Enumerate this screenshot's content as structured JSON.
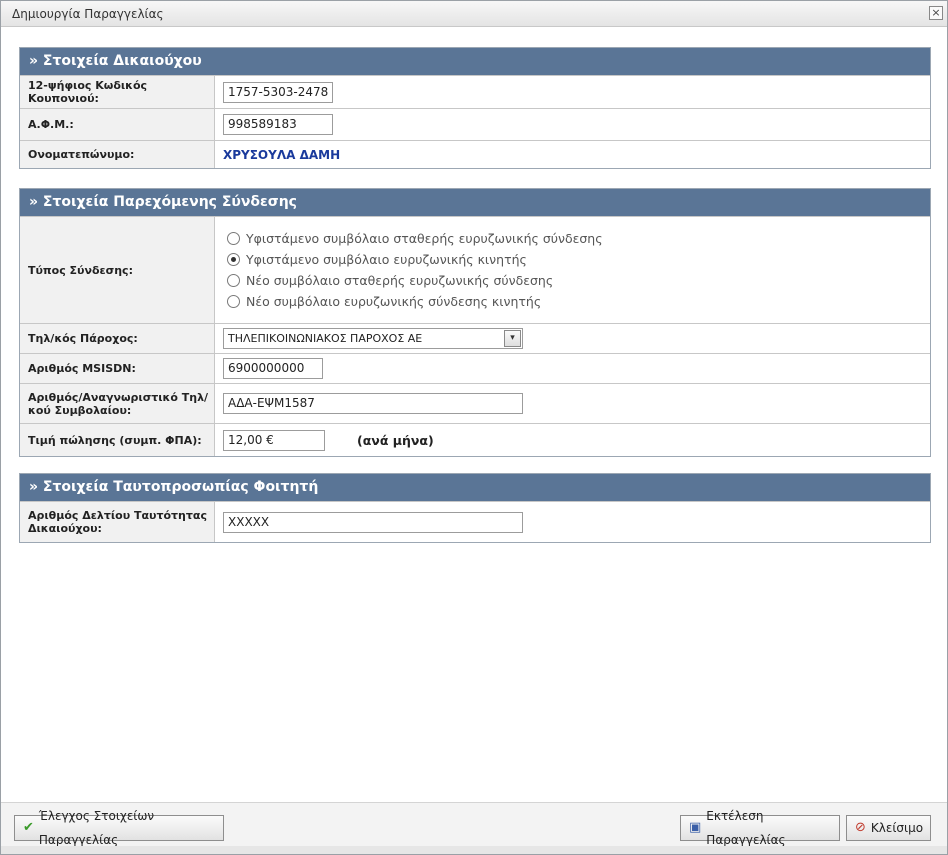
{
  "window": {
    "title": "Δημιουργία Παραγγελίας",
    "close_label": "×"
  },
  "beneficiary": {
    "header": "» Στοιχεία Δικαιούχου",
    "coupon_label": "12-ψήφιος Κωδικός Κουπονιού:",
    "coupon_value": "1757-5303-2478",
    "afm_label": "Α.Φ.Μ.:",
    "afm_value": "998589183",
    "name_label": "Ονοματεπώνυμο:",
    "name_value": "ΧΡΥΣΟΥΛΑ ΔΑΜΗ"
  },
  "connection": {
    "header": "» Στοιχεία Παρεχόμενης Σύνδεσης",
    "type_label": "Τύπος Σύνδεσης:",
    "type_options": [
      "Υφιστάμενο συμβόλαιο σταθερής ευρυζωνικής σύνδεσης",
      "Υφιστάμενο συμβόλαιο ευρυζωνικής κινητής",
      "Νέο συμβόλαιο σταθερής ευρυζωνικής σύνδεσης",
      "Νέο συμβόλαιο ευρυζωνικής σύνδεσης κινητής"
    ],
    "selected_option": 1,
    "provider_label": "Τηλ/κός Πάροχος:",
    "provider_value": "ΤΗΛΕΠΙΚΟΙΝΩΝΙΑΚΟΣ ΠΑΡΟΧΟΣ ΑΕ",
    "msisdn_label": "Αριθμός MSISDN:",
    "msisdn_value": "6900000000",
    "contract_label": "Αριθμός/Αναγνωριστικό Τηλ/κού Συμβολαίου:",
    "contract_value": "ΑΔΑ-ΕΨΜ1587",
    "price_label": "Τιμή πώλησης (συμπ. ΦΠΑ):",
    "price_value": "12,00 €",
    "price_suffix": "(ανά μήνα)"
  },
  "student": {
    "header": "» Στοιχεία Ταυτοπροσωπίας Φοιτητή",
    "id_label": "Αριθμός Δελτίου Ταυτότητας Δικαιούχου:",
    "id_value": "XXXXX"
  },
  "footer": {
    "check_button": "Έλεγχος Στοιχείων Παραγγελίας",
    "execute_button": "Εκτέλεση Παραγγελίας",
    "close_button": "Κλείσιμο"
  },
  "colors": {
    "section_header": "#5a7596",
    "name_value": "#1a3a9c"
  }
}
